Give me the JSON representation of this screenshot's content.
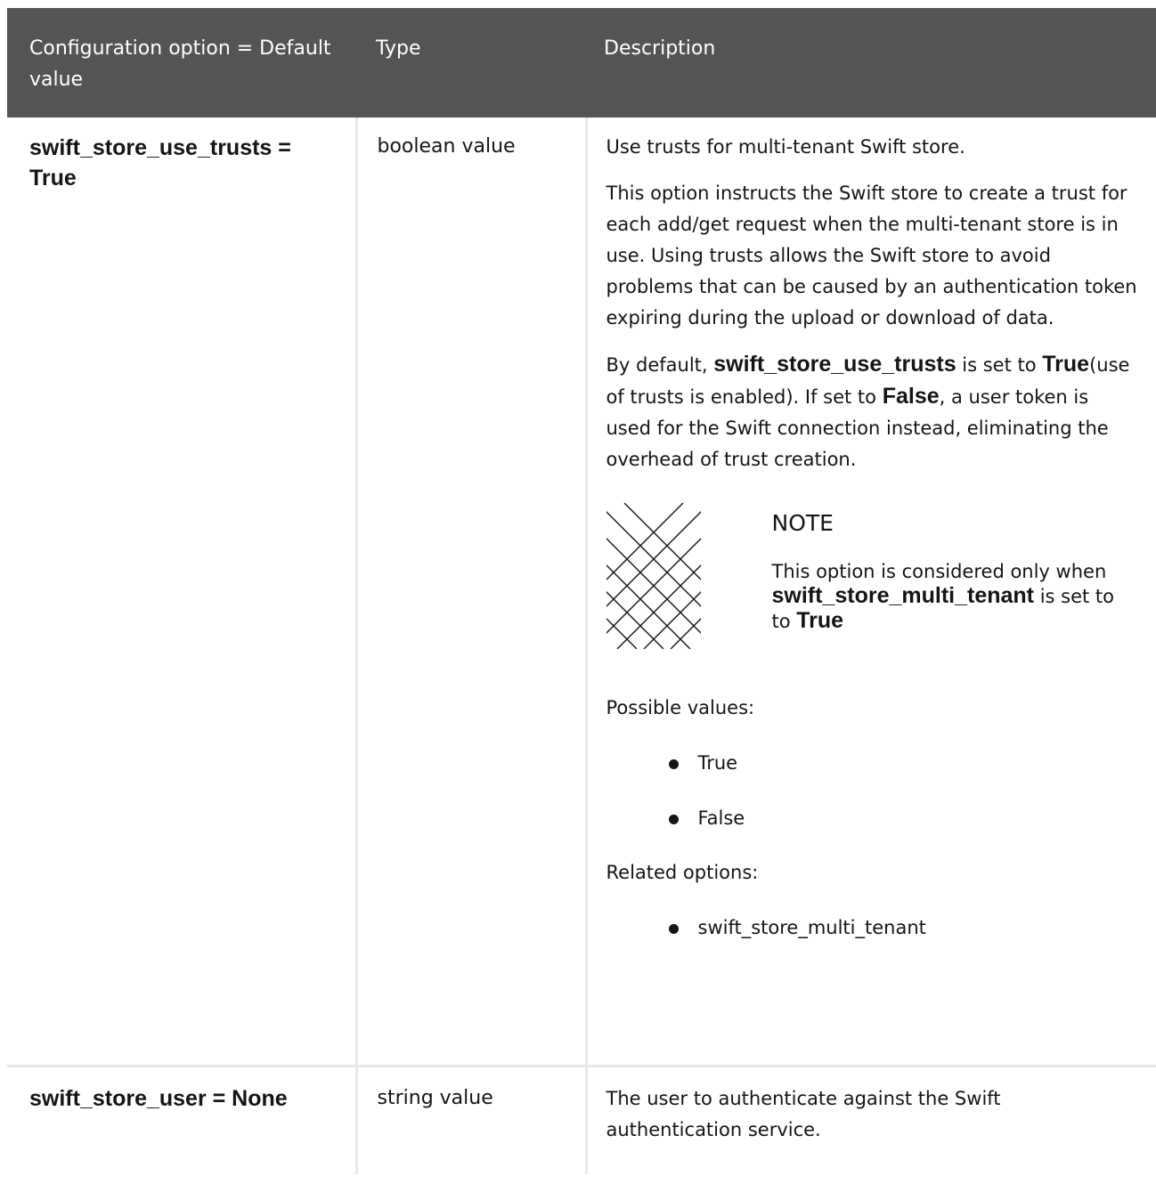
{
  "table": {
    "headers": {
      "option": "Configuration option = Default value",
      "type": "Type",
      "description": "Description"
    },
    "rows": [
      {
        "option": "swift_store_use_trusts = True",
        "type": "boolean value",
        "description": {
          "p1": "Use trusts for multi-tenant Swift store.",
          "p2": "This option instructs the Swift store to create a trust for each add/get request when the multi-tenant store is in use. Using trusts allows the Swift store to avoid problems that can be caused by an authentication token expiring during the upload or download of data.",
          "p3_prefix": "By default,",
          "p3_code1": "swift_store_use_trusts",
          "p3_mid": "is set to",
          "p3_code2": "True",
          "p3_mid2": "(use of trusts is enabled). If set to",
          "p3_code3": "False",
          "p3_suffix": ", a user token is used for the Swift connection instead, eliminating the overhead of trust creation.",
          "note_icon": "note-pattern-icon",
          "note_title": "NOTE",
          "note_prefix": "This option is considered only when",
          "note_code": "swift_store_multi_tenant",
          "note_mid": "is set to",
          "note_code2": "True",
          "possible_label": "Possible values:",
          "possible_values": [
            "True",
            "False"
          ],
          "related_label": "Related options:",
          "related_options": [
            "swift_store_multi_tenant"
          ]
        }
      },
      {
        "option": "swift_store_user = None",
        "type": "string value",
        "description": {
          "p1": "The user to authenticate against the Swift authentication service."
        }
      }
    ]
  }
}
